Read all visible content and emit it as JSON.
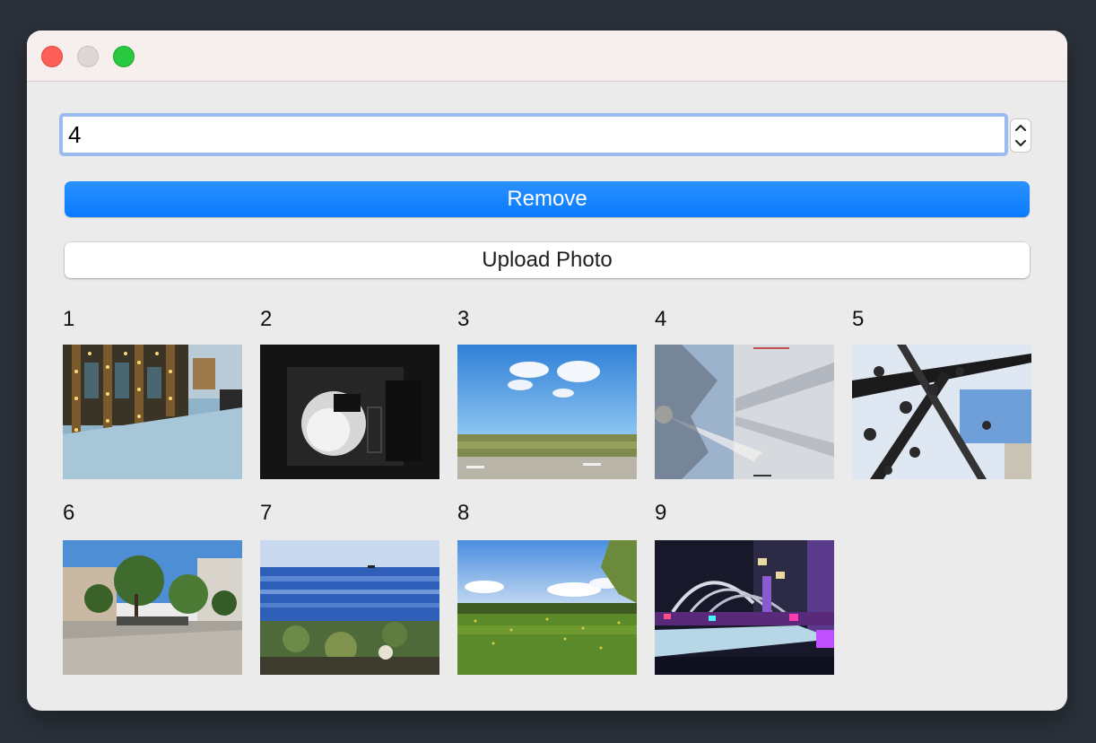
{
  "window": {
    "traffic_lights": [
      "close",
      "minimize",
      "maximize"
    ]
  },
  "spinbox": {
    "value": "4"
  },
  "buttons": {
    "remove_label": "Remove",
    "upload_label": "Upload Photo"
  },
  "photos": [
    {
      "label": "1",
      "icon": "photo-thumbnail"
    },
    {
      "label": "2",
      "icon": "photo-thumbnail"
    },
    {
      "label": "3",
      "icon": "photo-thumbnail"
    },
    {
      "label": "4",
      "icon": "photo-thumbnail"
    },
    {
      "label": "5",
      "icon": "photo-thumbnail"
    },
    {
      "label": "6",
      "icon": "photo-thumbnail"
    },
    {
      "label": "7",
      "icon": "photo-thumbnail"
    },
    {
      "label": "8",
      "icon": "photo-thumbnail"
    },
    {
      "label": "9",
      "icon": "photo-thumbnail"
    }
  ],
  "colors": {
    "accent": "#0a7aff",
    "focus_ring": "#9bbbef",
    "close": "#fe5f57",
    "maximize": "#28c840"
  }
}
